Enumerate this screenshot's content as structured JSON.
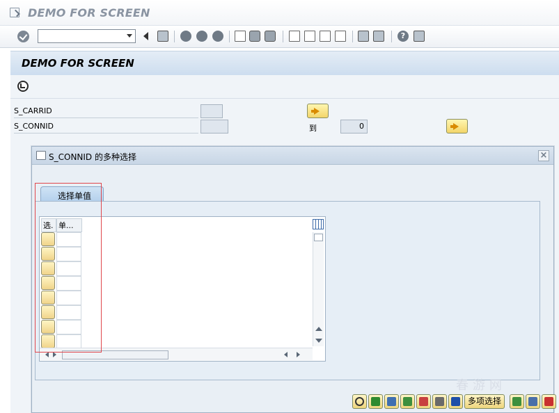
{
  "window": {
    "title": "DEMO FOR SCREEN"
  },
  "toolbar": {
    "command_placeholder": ""
  },
  "screen": {
    "title": "DEMO FOR SCREEN"
  },
  "fields": {
    "s_carrid": {
      "label": "S_CARRID"
    },
    "s_connid": {
      "label": "S_CONNID",
      "to_label": "到",
      "count": "0"
    }
  },
  "dialog": {
    "title": "S_CONNID 的多种选择",
    "tab_label": "选择单值",
    "grid": {
      "col_select": "选.",
      "col_value": "单...",
      "row_count_rows": [
        "",
        "",
        "",
        "",
        "",
        "",
        "",
        ""
      ]
    },
    "buttons": {
      "multi_select_label": "多项选择"
    }
  },
  "watermark": "春游网"
}
